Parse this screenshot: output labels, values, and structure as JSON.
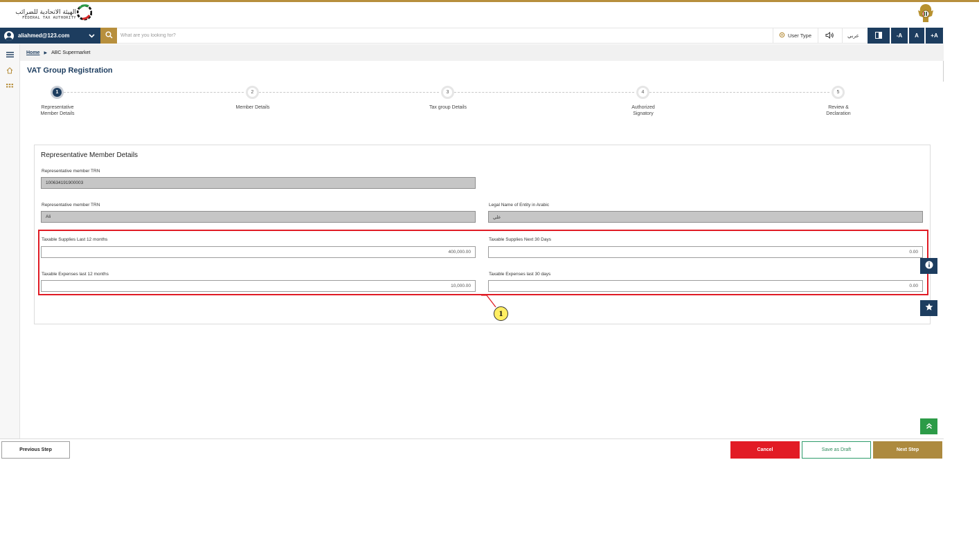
{
  "header": {
    "logo_ar": "الهيئة الاتحادية للضرائب",
    "logo_en": "FEDERAL TAX AUTHORITY"
  },
  "toolbar": {
    "user_email": "aliahmed@123.com",
    "search_placeholder": "What are you looking for?",
    "user_type_label": "User Type",
    "arabic_label": "عربي",
    "font_decrease": "-A",
    "font_normal": "A",
    "font_increase": "+A"
  },
  "breadcrumb": {
    "home": "Home",
    "current": "ABC Supermarket"
  },
  "page": {
    "title": "VAT Group Registration"
  },
  "steps": [
    {
      "number": "1",
      "label": "Representative\nMember Details",
      "active": true
    },
    {
      "number": "2",
      "label": "Member Details",
      "active": false
    },
    {
      "number": "3",
      "label": "Tax group Details",
      "active": false
    },
    {
      "number": "4",
      "label": "Authorized\nSignatory",
      "active": false
    },
    {
      "number": "5",
      "label": "Review &\nDeclaration",
      "active": false
    }
  ],
  "form": {
    "title": "Representative Member Details",
    "trn_label": "Representative member TRN",
    "trn_value": "100634191900003",
    "name_label": "Representative member TRN",
    "name_value": "Ali",
    "arabic_name_label": "Legal Name of Entity in Arabic",
    "arabic_name_value": "علي",
    "supplies_12m_label": "Taxable Supplies Last 12 months",
    "supplies_12m_value": "400,000.00",
    "supplies_30d_label": "Taxable Supplies Next 30 Days",
    "supplies_30d_value": "0.00",
    "expenses_12m_label": "Taxable Expenses last 12 months",
    "expenses_12m_value": "10,000.00",
    "expenses_30d_label": "Taxable Expenses last 30 days",
    "expenses_30d_value": "0.00"
  },
  "annotation": {
    "callout_number": "1",
    "highlight_color": "#e01b24"
  },
  "footer": {
    "previous": "Previous Step",
    "cancel": "Cancel",
    "save_draft": "Save as Draft",
    "next": "Next Step"
  },
  "colors": {
    "navy": "#1d3d5f",
    "gold": "#b78f3d",
    "cancel_red": "#e21b25",
    "scroll_green": "#2c9b47"
  }
}
